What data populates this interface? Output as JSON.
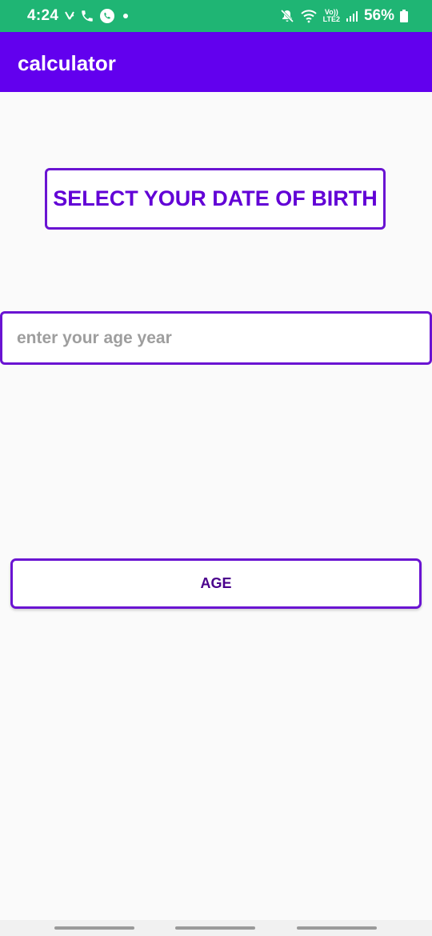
{
  "status_bar": {
    "time": "4:24",
    "battery_percent": "56%",
    "network_label_top": "Vo))",
    "network_label_bottom": "LTE2",
    "left_icons": [
      "missed-call-icon",
      "call-icon",
      "whatsapp-icon",
      "dot-icon"
    ],
    "right_icons": [
      "mute-icon",
      "wifi-icon",
      "signal-icon",
      "battery-icon"
    ],
    "background_color": "#1fb574"
  },
  "app_bar": {
    "title": "calculator",
    "background_color": "#6200ee"
  },
  "main": {
    "dob_button_label": "SELECT YOUR DATE OF BIRTH",
    "age_input_placeholder": "enter your age year",
    "age_input_value": "",
    "age_button_label": "AGE",
    "accent_color": "#6a14d2"
  }
}
